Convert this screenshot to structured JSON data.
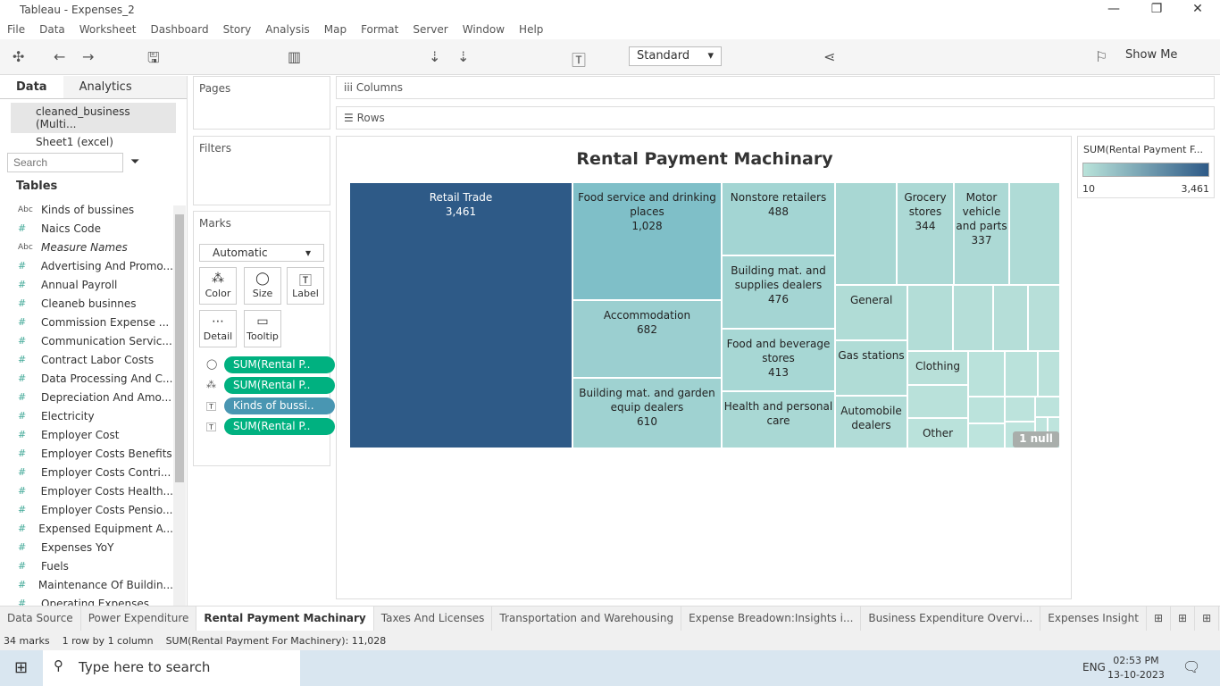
{
  "app": {
    "title": "Tableau - Expenses_2"
  },
  "menu": [
    "File",
    "Data",
    "Worksheet",
    "Dashboard",
    "Story",
    "Analysis",
    "Map",
    "Format",
    "Server",
    "Window",
    "Help"
  ],
  "toolbar": {
    "fit": "Standard",
    "show_me": "Show Me"
  },
  "left": {
    "tab_data": "Data",
    "tab_analytics": "Analytics",
    "sources": [
      "cleaned_business (Multi...",
      "Sheet1 (excel)"
    ],
    "search_placeholder": "Search",
    "tables_label": "Tables",
    "fields": [
      {
        "type": "Abc",
        "name": "Kinds of bussines"
      },
      {
        "type": "#",
        "name": "Naics Code"
      },
      {
        "type": "Abc",
        "name": "Measure Names"
      },
      {
        "type": "#",
        "name": "Advertising And Promo..."
      },
      {
        "type": "#",
        "name": "Annual Payroll"
      },
      {
        "type": "#",
        "name": "Cleaneb businnes"
      },
      {
        "type": "#",
        "name": "Commission Expense ..."
      },
      {
        "type": "#",
        "name": "Communication Servic..."
      },
      {
        "type": "#",
        "name": "Contract Labor Costs"
      },
      {
        "type": "#",
        "name": "Data Processing And C..."
      },
      {
        "type": "#",
        "name": "Depreciation And Amo..."
      },
      {
        "type": "#",
        "name": "Electricity"
      },
      {
        "type": "#",
        "name": "Employer Cost"
      },
      {
        "type": "#",
        "name": "Employer Costs Benefits"
      },
      {
        "type": "#",
        "name": "Employer Costs Contri..."
      },
      {
        "type": "#",
        "name": "Employer Costs Health..."
      },
      {
        "type": "#",
        "name": "Employer Costs Pensio..."
      },
      {
        "type": "#",
        "name": "Expensed Equipment A..."
      },
      {
        "type": "#",
        "name": "Expenses YoY"
      },
      {
        "type": "#",
        "name": "Fuels"
      },
      {
        "type": "#",
        "name": "Maintenance Of Buildin..."
      },
      {
        "type": "#",
        "name": "Operating Expenses"
      }
    ]
  },
  "cards": {
    "pages": "Pages",
    "filters": "Filters",
    "marks": "Marks",
    "columns": "Columns",
    "rows": "Rows",
    "mark_type": "Automatic",
    "mark_buttons": [
      "Color",
      "Size",
      "Label",
      "Detail",
      "Tooltip"
    ],
    "pills": [
      {
        "label": "SUM(Rental P..",
        "color": "#00b180"
      },
      {
        "label": "SUM(Rental P..",
        "color": "#00b180"
      },
      {
        "label": "Kinds of bussi..",
        "color": "#4996b2"
      },
      {
        "label": "SUM(Rental P..",
        "color": "#00b180"
      }
    ]
  },
  "view": {
    "title": "Rental Payment Machinary",
    "null_badge": "1 null"
  },
  "legend": {
    "title": "SUM(Rental Payment F...",
    "min": "10",
    "max": "3,461",
    "colors": [
      "#b9e3da",
      "#2e5a87"
    ]
  },
  "chart_data": {
    "type": "treemap",
    "title": "Rental Payment Machinary",
    "measure": "SUM(Rental Payment For Machinery)",
    "items": [
      {
        "label": "Retail Trade",
        "value": "3,461",
        "color": "#2e5a87"
      },
      {
        "label": "Food service and drinking places",
        "value": "1,028",
        "color": "#7fbfc8"
      },
      {
        "label": "Accommodation",
        "value": "682",
        "color": "#9bcfd0"
      },
      {
        "label": "Building mat. and garden equip dealers",
        "value": "610",
        "color": "#9fd2d1"
      },
      {
        "label": "Nonstore retailers",
        "value": "488",
        "color": "#a3d5d3"
      },
      {
        "label": "Building mat. and supplies dealers",
        "value": "476",
        "color": "#a4d5d3"
      },
      {
        "label": "Food and beverage stores",
        "value": "413",
        "color": "#a7d7d4"
      },
      {
        "label": "Health and personal care",
        "value": "",
        "color": "#a9d8d4"
      },
      {
        "label": "",
        "value": "",
        "color": "#a8d7d3"
      },
      {
        "label": "Grocery stores",
        "value": "344",
        "color": "#acd9d5"
      },
      {
        "label": "Motor vehicle and parts",
        "value": "337",
        "color": "#acd9d5"
      },
      {
        "label": "",
        "value": "",
        "color": "#afdbd6"
      },
      {
        "label": "General",
        "value": "",
        "color": "#b0dcd6"
      },
      {
        "label": "Gas stations",
        "value": "",
        "color": "#b0dcd6"
      },
      {
        "label": "Automobile dealers",
        "value": "",
        "color": "#b1dcd7"
      }
    ]
  },
  "tabs": [
    "Data Source",
    "Power Expenditure",
    "Rental Payment Machinary",
    "Taxes And Licenses",
    "Transportation and Warehousing",
    "Expense Breadown:Insights i...",
    "Business Expenditure Overvi...",
    "Expenses Insight"
  ],
  "status": {
    "marks": "34 marks",
    "grid": "1 row by 1 column",
    "sum": "SUM(Rental Payment For Machinery): 11,028"
  },
  "taskbar": {
    "search": "Type here to search",
    "lang": "ENG",
    "time": "02:53 PM",
    "date": "13-10-2023"
  }
}
